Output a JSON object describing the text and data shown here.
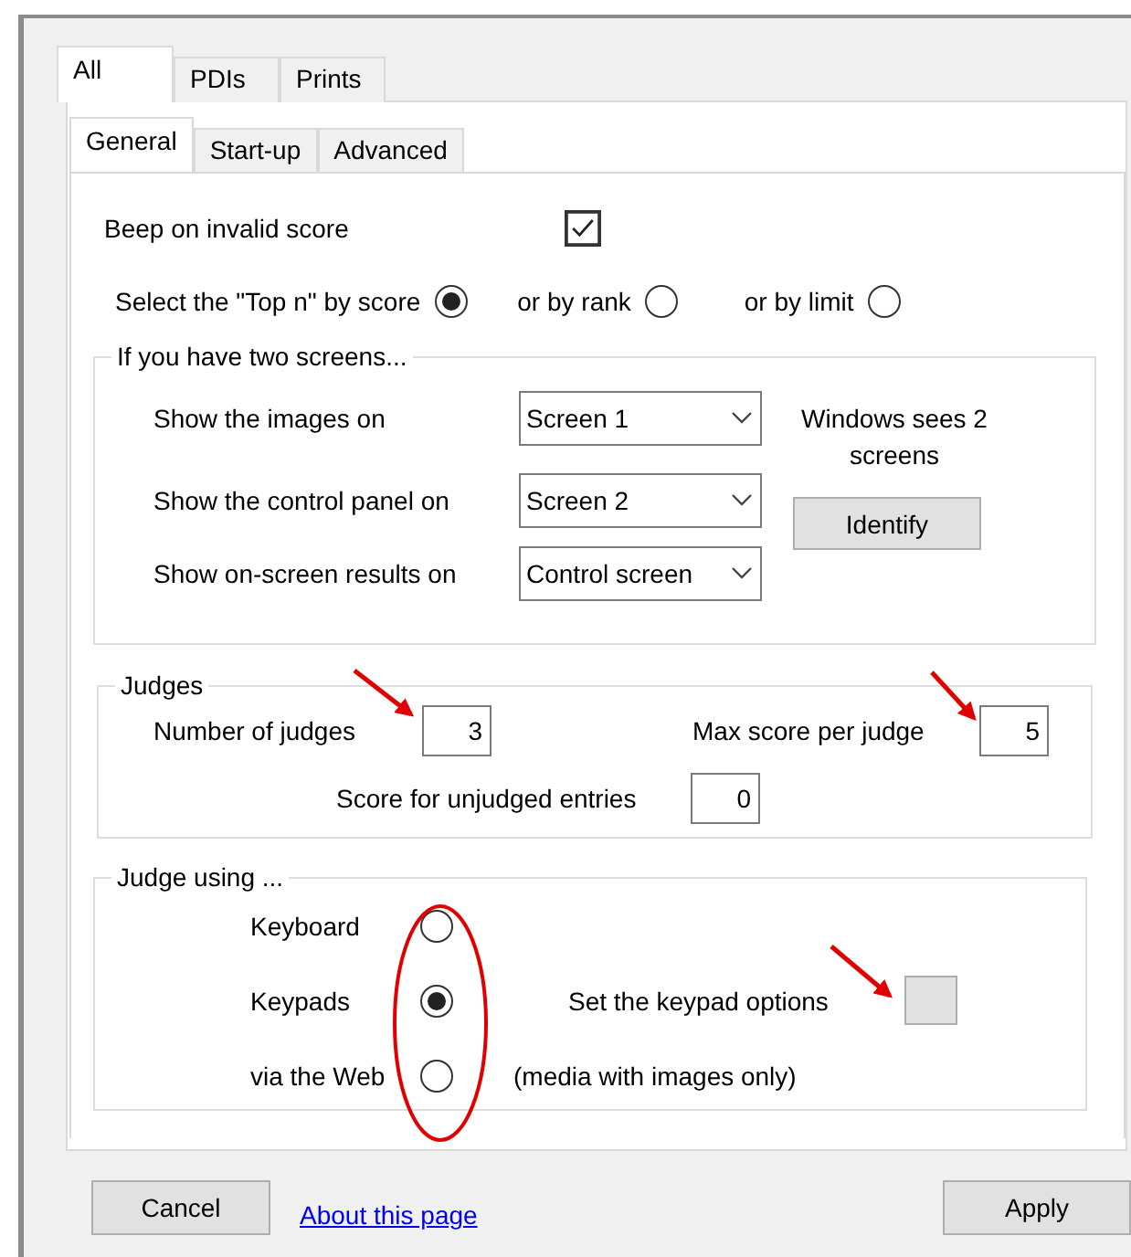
{
  "outer_tabs": [
    {
      "label": "All",
      "selected": true
    },
    {
      "label": "PDIs",
      "selected": false
    },
    {
      "label": "Prints",
      "selected": false
    }
  ],
  "inner_tabs": [
    {
      "label": "General",
      "selected": true
    },
    {
      "label": "Start-up",
      "selected": false
    },
    {
      "label": "Advanced",
      "selected": false
    }
  ],
  "beep": {
    "label": "Beep on invalid score",
    "checked": true
  },
  "top_n": [
    {
      "label": "Select the \"Top n\" by score",
      "selected": true
    },
    {
      "label": "or by rank",
      "selected": false
    },
    {
      "label": "or by limit",
      "selected": false
    }
  ],
  "screens": {
    "title": "If you have two screens...",
    "rows": [
      {
        "label": "Show the images on",
        "value": "Screen 1"
      },
      {
        "label": "Show the control panel on",
        "value": "Screen 2"
      },
      {
        "label": "Show on-screen results on",
        "value": "Control screen"
      }
    ],
    "status": "Windows sees 2 screens",
    "identify_button": "Identify"
  },
  "judges": {
    "title": "Judges",
    "number_label": "Number of judges",
    "number_value": "3",
    "max_label": "Max score per judge",
    "max_value": "5",
    "unjudged_label": "Score for unjudged entries",
    "unjudged_value": "0"
  },
  "judge_using": {
    "title": "Judge using ...",
    "options": [
      {
        "label": "Keyboard",
        "selected": false
      },
      {
        "label": "Keypads",
        "selected": true
      },
      {
        "label": "via the Web",
        "selected": false
      }
    ],
    "keypad_options_label": "Set the keypad options",
    "web_note": "(media with images only)"
  },
  "buttons": {
    "cancel": "Cancel",
    "about_link": "About this page",
    "apply": "Apply"
  }
}
